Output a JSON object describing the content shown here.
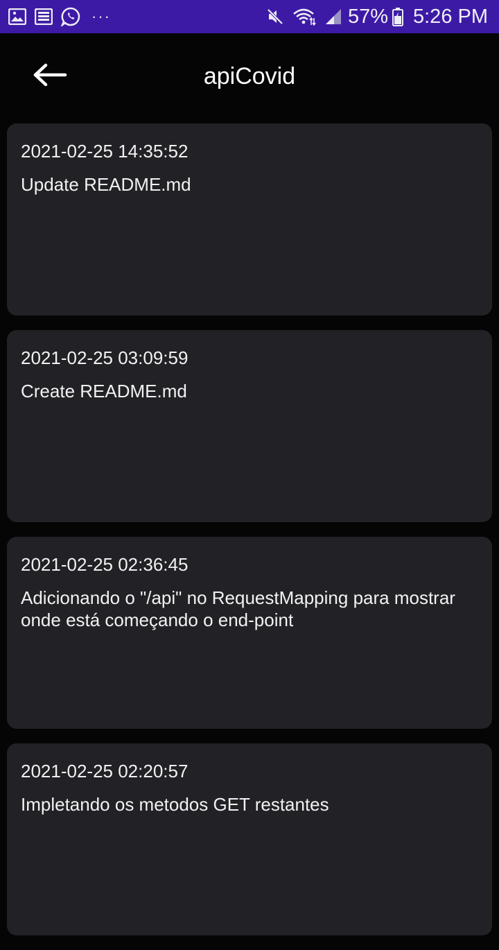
{
  "status_bar": {
    "icons_left": [
      "gallery-icon",
      "news-icon",
      "whatsapp-icon",
      "more-notifications-icon"
    ],
    "more_dots": "···",
    "icons_right": [
      "mute-icon",
      "wifi-icon",
      "signal-icon",
      "battery-icon"
    ],
    "battery_percent": "57%",
    "time": "5:26 PM",
    "background_color": "#3d1aa6"
  },
  "app_bar": {
    "title": "apiCovid",
    "back_icon": "arrow-left-icon"
  },
  "commits": [
    {
      "date": "2021-02-25 14:35:52",
      "message": "Update README.md"
    },
    {
      "date": "2021-02-25 03:09:59",
      "message": "Create README.md"
    },
    {
      "date": "2021-02-25 02:36:45",
      "message": "Adicionando o \"/api\" no RequestMapping para mostrar onde está começando o end-point"
    },
    {
      "date": "2021-02-25 02:20:57",
      "message": "Impletando os metodos GET restantes"
    }
  ],
  "colors": {
    "background": "#050505",
    "card": "#212126",
    "text": "#f2f2f2"
  }
}
